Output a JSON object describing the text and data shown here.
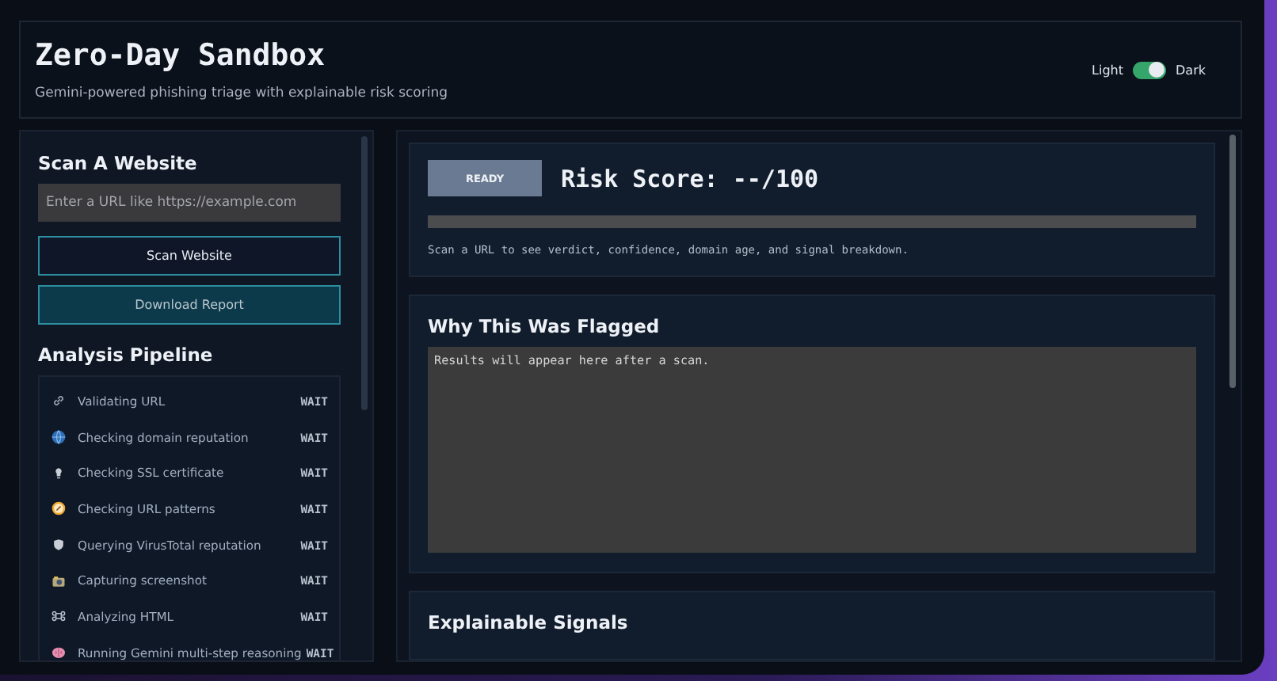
{
  "header": {
    "title": "Zero-Day Sandbox",
    "subtitle": "Gemini-powered phishing triage with explainable risk scoring",
    "theme_toggle": {
      "left_label": "Light",
      "right_label": "Dark",
      "on": true
    }
  },
  "scan": {
    "heading": "Scan A Website",
    "url_field": {
      "placeholder": "Enter a URL like https://example.com"
    },
    "scan_button": "Scan Website",
    "download_button": "Download Report"
  },
  "pipeline": {
    "heading": "Analysis Pipeline",
    "steps": [
      {
        "kind": "link",
        "label": "Validating URL",
        "status": "WAIT"
      },
      {
        "kind": "globe",
        "label": "Checking domain reputation",
        "status": "WAIT"
      },
      {
        "kind": "lock",
        "label": "Checking SSL certificate",
        "status": "WAIT"
      },
      {
        "kind": "compass",
        "label": "Checking URL patterns",
        "status": "WAIT"
      },
      {
        "kind": "shield",
        "label": "Querying VirusTotal reputation",
        "status": "WAIT"
      },
      {
        "kind": "camera",
        "label": "Capturing screenshot",
        "status": "WAIT"
      },
      {
        "kind": "command",
        "label": "Analyzing HTML",
        "status": "WAIT"
      },
      {
        "kind": "brain",
        "label": "Running Gemini multi-step reasoning",
        "status": "WAIT"
      }
    ]
  },
  "risk": {
    "badge": "READY",
    "score": "Risk Score: --/100",
    "level": 0,
    "hint": "Scan a URL to see verdict, confidence, domain age, and signal breakdown."
  },
  "flagged": {
    "heading": "Why This Was Flagged",
    "output": "Results will appear here after a scan."
  },
  "signals": {
    "heading": "Explainable Signals"
  }
}
